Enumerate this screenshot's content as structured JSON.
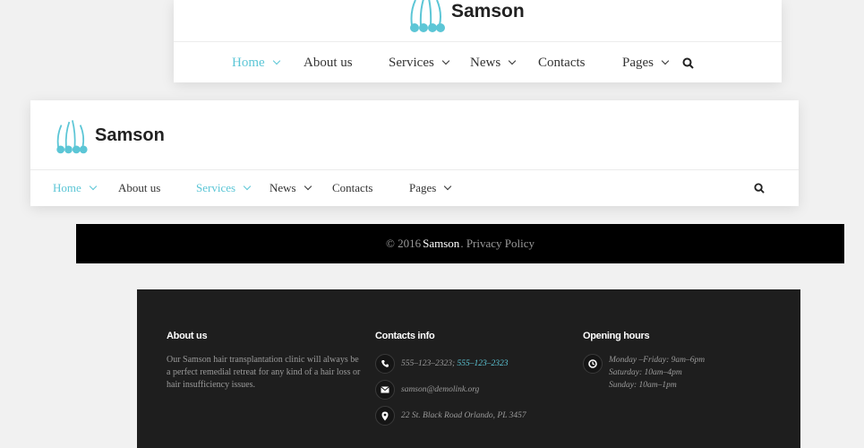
{
  "brand": {
    "name": "Samson",
    "accent_color": "#5cc6d6"
  },
  "header_centered": {
    "logo_text": "Samson",
    "nav": [
      "Home",
      "About us",
      "Services",
      "News",
      "Contacts",
      "Pages"
    ],
    "active": "Home",
    "search_icon": "search-icon"
  },
  "header_left": {
    "logo_text": "Samson",
    "nav": [
      "Home",
      "About us",
      "Services",
      "News",
      "Contacts",
      "Pages"
    ],
    "active": [
      "Home",
      "Services"
    ],
    "search_icon": "search-icon"
  },
  "copyright": {
    "prefix": "© 2016 ",
    "brand": "Samson",
    "suffix": ". Privacy Policy"
  },
  "footer": {
    "about": {
      "title": "About us",
      "text": "Our Samson hair transplantation clinic will always be a perfect remedial retreat for any kind of a hair loss or hair insufficiency issues."
    },
    "contacts": {
      "title": "Contacts info",
      "phone_main": "555–123–2323;",
      "phone_link": "555–123–2323",
      "email": "samson@demolink.org",
      "address": "22 St. Black Road Orlando, PL 3457"
    },
    "hours": {
      "title": "Opening hours",
      "weekdays": "Monday –Friday: 9am–6pm",
      "saturday": "Saturday: 10am–4pm",
      "sunday": "Sunday: 10am–1pm"
    }
  }
}
